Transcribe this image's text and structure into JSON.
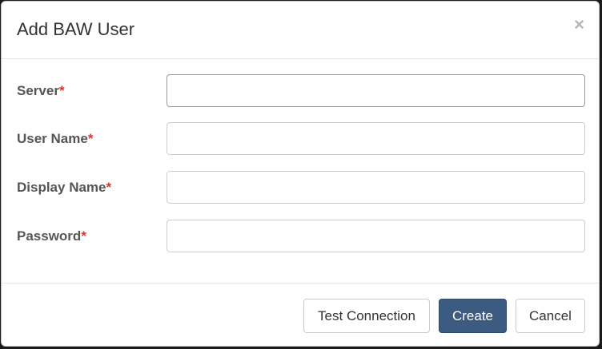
{
  "dialog": {
    "title": "Add BAW User",
    "close_glyph": "×"
  },
  "form": {
    "required_marker": "*",
    "fields": [
      {
        "label": "Server",
        "value": "",
        "placeholder": ""
      },
      {
        "label": "User Name",
        "value": "",
        "placeholder": ""
      },
      {
        "label": "Display Name",
        "value": "",
        "placeholder": ""
      },
      {
        "label": "Password",
        "value": "",
        "placeholder": ""
      }
    ]
  },
  "footer": {
    "test_connection_label": "Test Connection",
    "create_label": "Create",
    "cancel_label": "Cancel"
  },
  "colors": {
    "primary": "#3b5b80",
    "required": "#d9372b"
  }
}
